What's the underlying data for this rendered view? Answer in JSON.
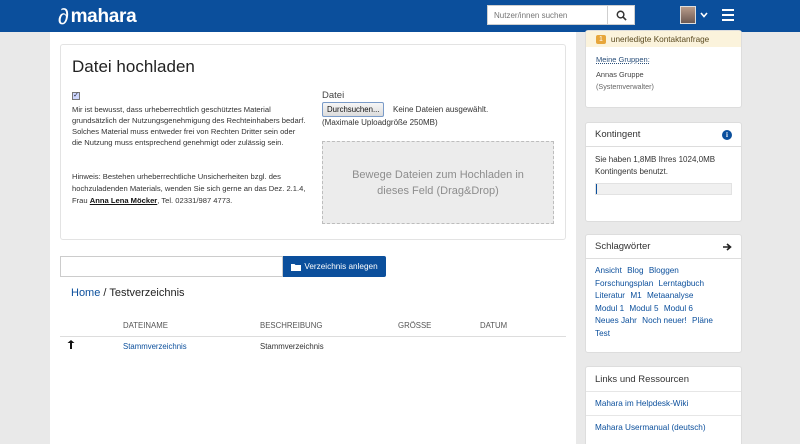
{
  "header": {
    "logo_text": "mahara",
    "search_placeholder": "Nutzer/innen suchen",
    "search_icon": "search-icon",
    "menu_icon": "hamburger-icon"
  },
  "upload": {
    "title": "Datei hochladen",
    "consent_text": "Mir ist bewusst, dass urheberrechtlich geschütztes Material grundsätzlich der Nutzungsgenehmigung des Rechteinhabers bedarf. Solches Material muss entweder frei von Rechten Dritter sein oder die Nutzung muss entsprechend genehmigt oder zulässig sein.",
    "hint_prefix": "Hinweis: Bestehen urheberrechtliche Unsicherheiten bzgl. des hochzuladenden Materials, wenden Sie sich gerne an das Dez. 2.1.4, Frau ",
    "hint_name": "Anna Lena Möcker",
    "hint_suffix": ", Tel. 02331/987 4773.",
    "file_label": "Datei",
    "browse_label": "Durchsuchen...",
    "no_file_text": "Keine Dateien ausgewählt.",
    "max_size_text": "(Maximale Uploadgröße 250MB)",
    "dropzone_text": "Bewege Dateien zum Hochladen in dieses Feld (Drag&Drop)"
  },
  "folder": {
    "create_label": "Verzeichnis anlegen",
    "create_icon": "folder-icon"
  },
  "breadcrumb": {
    "home": "Home",
    "separator": " / ",
    "current": "Testverzeichnis"
  },
  "table": {
    "columns": [
      "DATEINAME",
      "BESCHREIBUNG",
      "GRÖSSE",
      "DATUM"
    ],
    "rows": [
      {
        "icon": "parent-folder-icon",
        "name": "Stammverzeichnis",
        "description": "Stammverzeichnis"
      }
    ]
  },
  "sidebar": {
    "pending_badge": "1",
    "pending_text": "unerledigte Kontaktanfrage",
    "groups_title": "Meine Gruppen:",
    "group_name": "Annas Gruppe",
    "group_role": "(Systemverwalter)",
    "quota_title": "Kontingent",
    "quota_text": "Sie haben 1,8MB Ihres 1024,0MB Kontingents benutzt.",
    "quota_used_fraction": 0.0018,
    "tags_title": "Schlagwörter",
    "tags": [
      "Ansicht",
      "Blog",
      "Bloggen",
      "Forschungsplan",
      "Lerntagbuch",
      "Literatur",
      "M1",
      "Metaanalyse",
      "Modul 1",
      "Modul 5",
      "Modul 6",
      "Neues Jahr",
      "Noch neuer!",
      "Pläne",
      "Test"
    ],
    "links_title": "Links und Ressourcen",
    "links": [
      "Mahara im Helpdesk-Wiki",
      "Mahara Usermanual (deutsch)"
    ]
  },
  "colors": {
    "brand": "#0b4f9c",
    "pending_bg": "#fbf3dc",
    "badge": "#e7a63b"
  }
}
